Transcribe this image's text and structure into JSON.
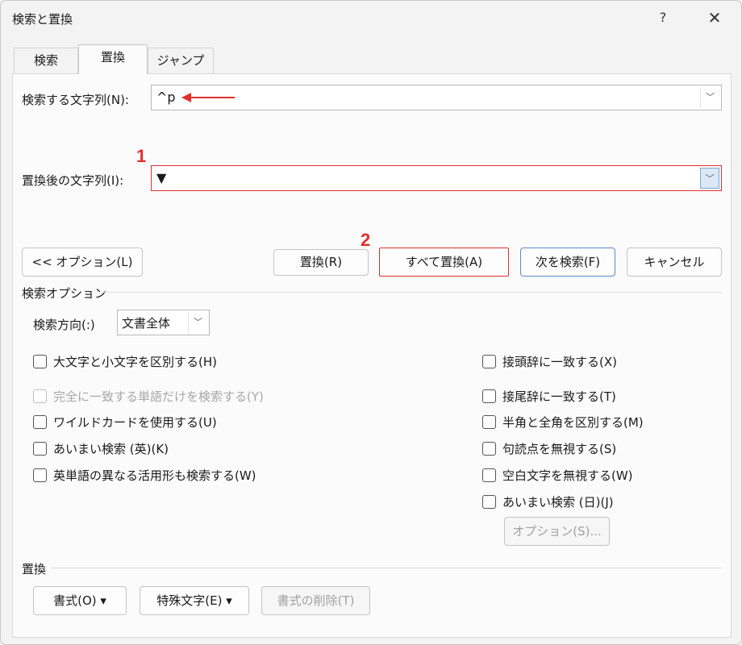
{
  "window": {
    "title": "検索と置換",
    "help": "?",
    "close": "✕"
  },
  "tabs": [
    {
      "label": "検索",
      "active": false
    },
    {
      "label": "置換",
      "active": true
    },
    {
      "label": "ジャンプ",
      "active": false
    }
  ],
  "find": {
    "label": "検索する文字列(N):",
    "value": "^p"
  },
  "replace": {
    "label": "置換後の文字列(I):",
    "value": "▼"
  },
  "annotations": {
    "marker1": "1",
    "marker2": "2",
    "accent_color": "#e03030"
  },
  "buttons": {
    "options": "<< オプション(L)",
    "replace": "置換(R)",
    "replace_all": "すべて置換(A)",
    "find_next": "次を検索(F)",
    "cancel": "キャンセル"
  },
  "search_options": {
    "heading": "検索オプション",
    "direction_label": "検索方向(:)",
    "direction_value": "文書全体",
    "left_checks": [
      {
        "label": "大文字と小文字を区別する(H)",
        "checked": false,
        "enabled": true
      },
      {
        "label": "完全に一致する単語だけを検索する(Y)",
        "checked": false,
        "enabled": false
      },
      {
        "label": "ワイルドカードを使用する(U)",
        "checked": false,
        "enabled": true
      },
      {
        "label": "あいまい検索 (英)(K)",
        "checked": false,
        "enabled": true
      },
      {
        "label": "英単語の異なる活用形も検索する(W)",
        "checked": false,
        "enabled": true
      }
    ],
    "right_checks": [
      {
        "label": "接頭辞に一致する(X)",
        "checked": false,
        "enabled": true
      },
      {
        "label": "接尾辞に一致する(T)",
        "checked": false,
        "enabled": true
      },
      {
        "label": "半角と全角を区別する(M)",
        "checked": false,
        "enabled": true
      },
      {
        "label": "句読点を無視する(S)",
        "checked": false,
        "enabled": true
      },
      {
        "label": "空白文字を無視する(W)",
        "checked": false,
        "enabled": true
      },
      {
        "label": "あいまい検索 (日)(J)",
        "checked": false,
        "enabled": true
      }
    ],
    "fuzzy_options_button": "オプション(S)..."
  },
  "replace_section": {
    "heading": "置換",
    "format_button": "書式(O) ▾",
    "special_button": "特殊文字(E) ▾",
    "clear_format_button": "書式の削除(T)"
  }
}
